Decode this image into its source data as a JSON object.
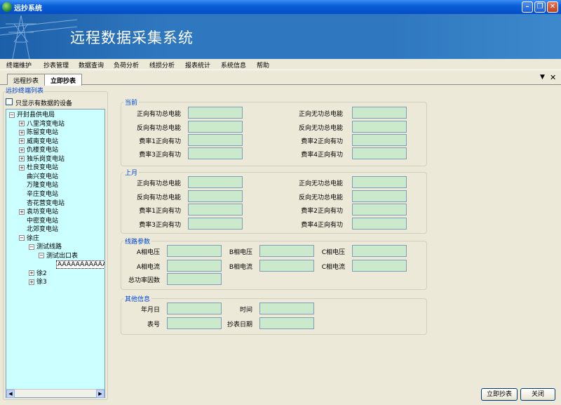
{
  "window": {
    "title": "远抄系统",
    "min_icon": "minimize-icon",
    "max_icon": "maximize-icon",
    "close_icon": "close-icon"
  },
  "banner": {
    "title": "远程数据采集系统"
  },
  "menu": [
    "终端维护",
    "抄表管理",
    "数据查询",
    "负荷分析",
    "线损分析",
    "报表统计",
    "系统信息",
    "帮助"
  ],
  "tabs": [
    {
      "label": "远程抄表",
      "active": false
    },
    {
      "label": "立即抄表",
      "active": true
    }
  ],
  "left": {
    "group_title": "远抄终端列表",
    "checkbox_label": "只显示有数据的设备",
    "checkbox_checked": false,
    "tree": [
      {
        "label": "开封县供电局",
        "level": 0,
        "expander": "-"
      },
      {
        "label": "八里湾变电站",
        "level": 1,
        "expander": "+"
      },
      {
        "label": "陈留变电站",
        "level": 1,
        "expander": "+"
      },
      {
        "label": "威南变电站",
        "level": 1,
        "expander": "+"
      },
      {
        "label": "仇楼变电站",
        "level": 1,
        "expander": "+"
      },
      {
        "label": "独乐岗变电站",
        "level": 1,
        "expander": "+"
      },
      {
        "label": "杜良变电站",
        "level": 1,
        "expander": "+"
      },
      {
        "label": "曲兴变电站",
        "level": 1,
        "expander": ""
      },
      {
        "label": "万隆变电站",
        "level": 1,
        "expander": ""
      },
      {
        "label": "辛庄变电站",
        "level": 1,
        "expander": ""
      },
      {
        "label": "杏花营变电站",
        "level": 1,
        "expander": ""
      },
      {
        "label": "袁坊变电站",
        "level": 1,
        "expander": "+"
      },
      {
        "label": "中密变电站",
        "level": 1,
        "expander": ""
      },
      {
        "label": "北郊变电站",
        "level": 1,
        "expander": ""
      },
      {
        "label": "徐庄",
        "level": 1,
        "expander": "-"
      },
      {
        "label": "测试线路",
        "level": 2,
        "expander": "-"
      },
      {
        "label": "测试出口表",
        "level": 3,
        "expander": "-"
      },
      {
        "label": "AAAAAAAAAAA",
        "level": 4,
        "expander": "",
        "selected": true
      },
      {
        "label": "徐2",
        "level": 2,
        "expander": "+"
      },
      {
        "label": "徐3",
        "level": 2,
        "expander": "+"
      }
    ]
  },
  "groups": {
    "current": {
      "title": "当前",
      "fields": [
        {
          "label": "正向有功总电能",
          "value": ""
        },
        {
          "label": "正向无功总电能",
          "value": ""
        },
        {
          "label": "反向有功总电能",
          "value": ""
        },
        {
          "label": "反向无功总电能",
          "value": ""
        },
        {
          "label": "费率1正向有功",
          "value": ""
        },
        {
          "label": "费率2正向有功",
          "value": ""
        },
        {
          "label": "费率3正向有功",
          "value": ""
        },
        {
          "label": "费率4正向有功",
          "value": ""
        }
      ]
    },
    "last_month": {
      "title": "上月",
      "fields": [
        {
          "label": "正向有功总电能",
          "value": ""
        },
        {
          "label": "正向无功总电能",
          "value": ""
        },
        {
          "label": "反向有功总电能",
          "value": ""
        },
        {
          "label": "反向无功总电能",
          "value": ""
        },
        {
          "label": "费率1正向有功",
          "value": ""
        },
        {
          "label": "费率2正向有功",
          "value": ""
        },
        {
          "label": "费率3正向有功",
          "value": ""
        },
        {
          "label": "费率4正向有功",
          "value": ""
        }
      ]
    },
    "line": {
      "title": "线路参数",
      "fields": [
        {
          "label": "A相电压",
          "value": ""
        },
        {
          "label": "B相电压",
          "value": ""
        },
        {
          "label": "C相电压",
          "value": ""
        },
        {
          "label": "A相电流",
          "value": ""
        },
        {
          "label": "B相电流",
          "value": ""
        },
        {
          "label": "C相电流",
          "value": ""
        },
        {
          "label": "总功率因数",
          "value": ""
        }
      ]
    },
    "other": {
      "title": "其他信息",
      "fields": [
        {
          "label": "年月日",
          "value": ""
        },
        {
          "label": "时间",
          "value": ""
        },
        {
          "label": "表号",
          "value": ""
        },
        {
          "label": "抄表日期",
          "value": ""
        }
      ]
    }
  },
  "buttons": {
    "read_now": "立即抄表",
    "close": "关闭"
  },
  "colors": {
    "field_bg": "#cbe9cb",
    "tree_bg": "#ccffff",
    "group_title": "#0046d5"
  }
}
